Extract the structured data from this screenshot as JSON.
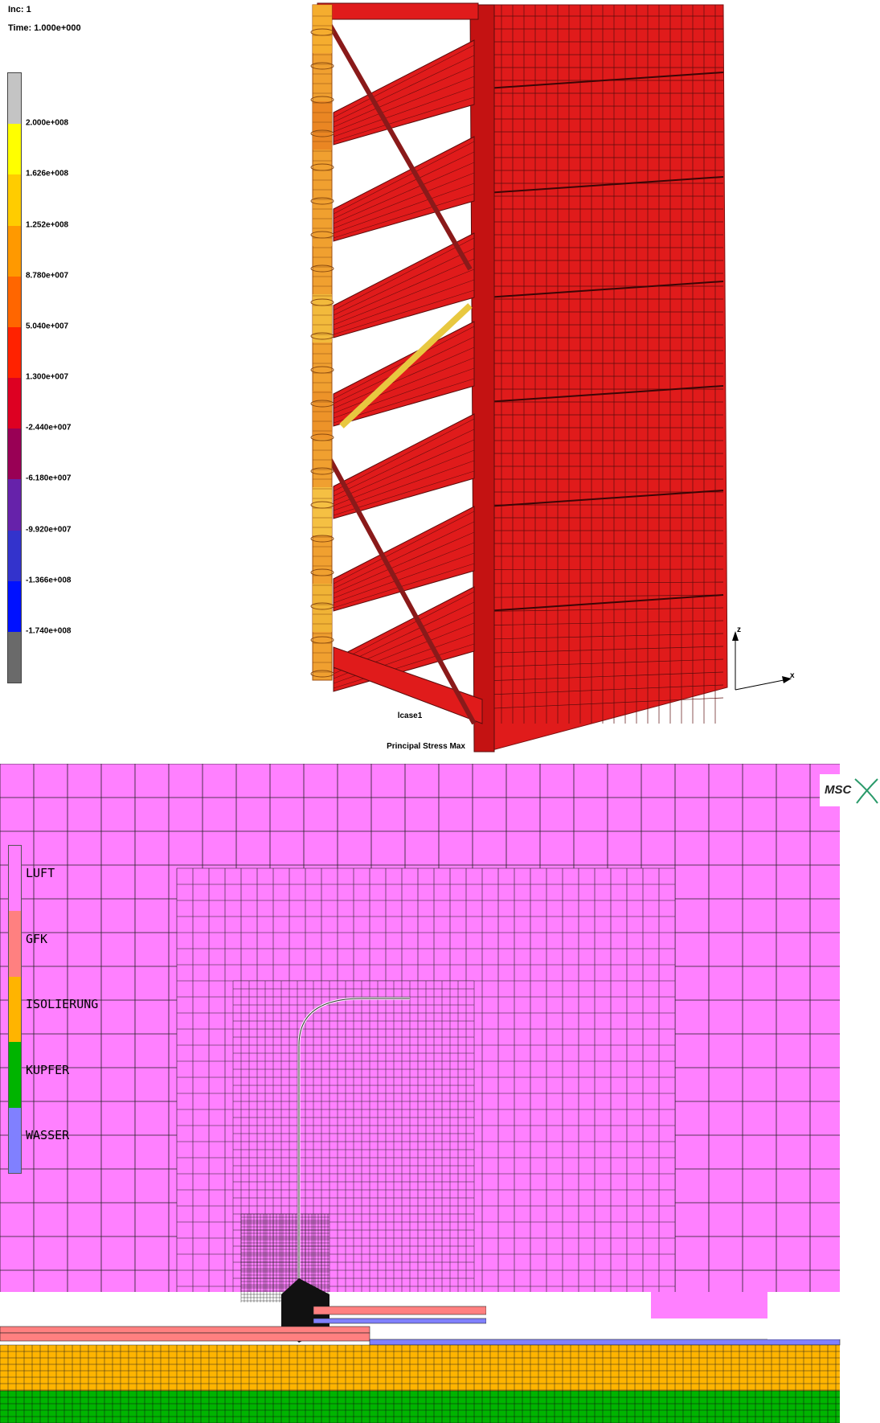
{
  "top": {
    "inc_label": "Inc:  1",
    "time_label": "Time:  1.000e+000",
    "scale_values": [
      "2.000e+008",
      "1.626e+008",
      "1.252e+008",
      "8.780e+007",
      "5.040e+007",
      "1.300e+007",
      "-2.440e+007",
      "-6.180e+007",
      "-9.920e+007",
      "-1.366e+008",
      "-1.740e+008"
    ],
    "scale_colors": [
      "#c4c4c4",
      "#ffff00",
      "#ffcc00",
      "#ff9900",
      "#ff6600",
      "#ff2200",
      "#dd0022",
      "#990055",
      "#6622aa",
      "#3333cc",
      "#0011ff",
      "#6a6a6a"
    ],
    "lcase": "lcase1",
    "result_name": "Principal Stress Max",
    "axis_z": "z",
    "axis_x": "x",
    "structure_color": "#e01b1b",
    "post_color": "#f0a030"
  },
  "bottom": {
    "materials": [
      "LUFT",
      "GFK",
      "ISOLIERUNG",
      "KUPFER",
      "WASSER"
    ],
    "material_colors": [
      "#ff80ff",
      "#ff8080",
      "#ffb400",
      "#00b400",
      "#8080ff"
    ],
    "logo_text": "MSC"
  }
}
